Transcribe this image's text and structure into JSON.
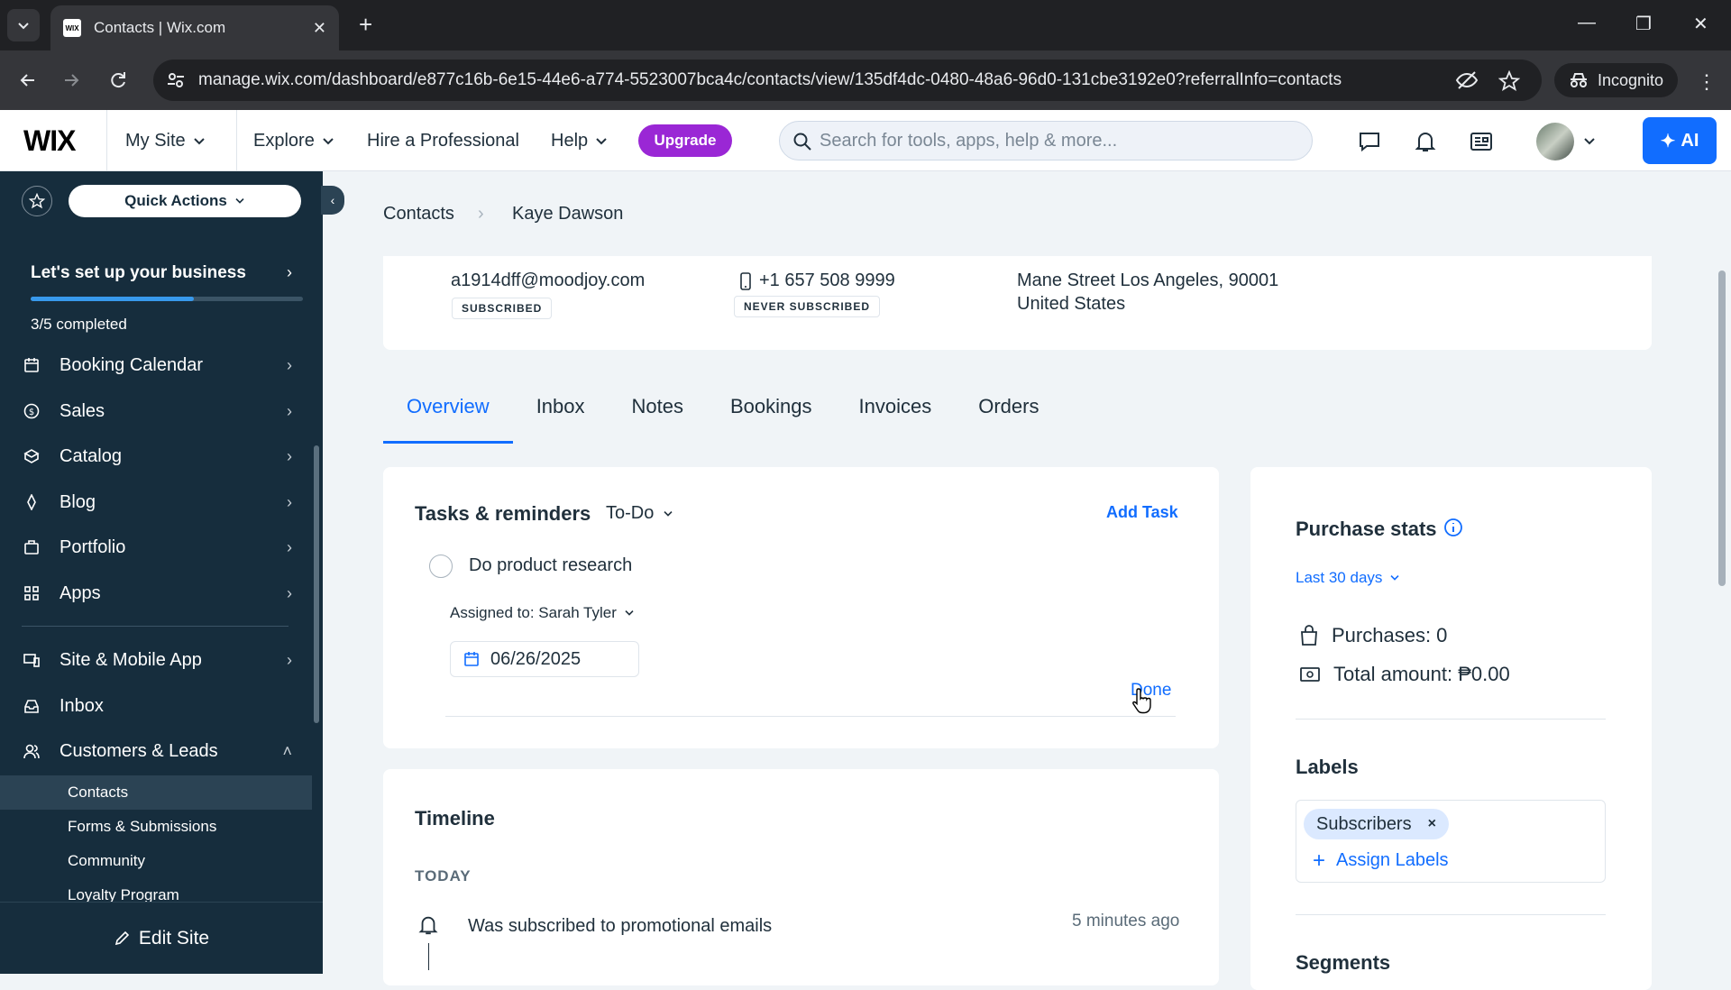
{
  "browser": {
    "tab_title": "Contacts | Wix.com",
    "url": "manage.wix.com/dashboard/e877c16b-6e15-44e6-a774-5523007bca4c/contacts/view/135df4dc-0480-48a6-96d0-131cbe3192e0?referralInfo=contacts",
    "incognito_label": "Incognito"
  },
  "header": {
    "logo": "WIX",
    "my_site": "My Site",
    "explore": "Explore",
    "hire": "Hire a Professional",
    "help": "Help",
    "upgrade": "Upgrade",
    "search_placeholder": "Search for tools, apps, help & more...",
    "ai_label": "AI",
    "accent": "#116dff",
    "upgrade_color": "#9a27d5"
  },
  "sidebar": {
    "quick_actions": "Quick Actions",
    "setup_title": "Let's set up your business",
    "setup_progress": 0.6,
    "setup_count": "3/5 completed",
    "items": [
      {
        "label": "Booking Calendar",
        "icon": "calendar-icon"
      },
      {
        "label": "Sales",
        "icon": "dollar-icon"
      },
      {
        "label": "Catalog",
        "icon": "catalog-icon"
      },
      {
        "label": "Blog",
        "icon": "pen-icon"
      },
      {
        "label": "Portfolio",
        "icon": "portfolio-icon"
      },
      {
        "label": "Apps",
        "icon": "apps-icon"
      },
      {
        "label": "Site & Mobile App",
        "icon": "devices-icon"
      },
      {
        "label": "Inbox",
        "icon": "inbox-icon"
      },
      {
        "label": "Customers & Leads",
        "icon": "people-icon"
      }
    ],
    "sub_items": [
      "Contacts",
      "Forms & Submissions",
      "Community",
      "Loyalty Program"
    ],
    "edit_site": "Edit Site"
  },
  "breadcrumb": {
    "parent": "Contacts",
    "current": "Kaye Dawson"
  },
  "contact": {
    "email": "a1914dff@moodjoy.com",
    "email_status": "SUBSCRIBED",
    "phone": "+1 657 508 9999",
    "phone_status": "NEVER SUBSCRIBED",
    "address_line1": "Mane Street Los Angeles, 90001",
    "address_line2": "United States"
  },
  "tabs": [
    "Overview",
    "Inbox",
    "Notes",
    "Bookings",
    "Invoices",
    "Orders"
  ],
  "tasks": {
    "title": "Tasks & reminders",
    "filter": "To-Do",
    "add_task": "Add Task",
    "task_title": "Do product research",
    "assigned": "Assigned to: Sarah Tyler",
    "due_date": "06/26/2025",
    "done": "Done"
  },
  "timeline": {
    "title": "Timeline",
    "group": "TODAY",
    "event": "Was subscribed to promotional emails",
    "time": "5 minutes ago"
  },
  "purchase_stats": {
    "title": "Purchase stats",
    "range": "Last 30 days",
    "purchases": "Purchases: 0",
    "total": "Total amount: ₱0.00"
  },
  "labels": {
    "title": "Labels",
    "chip": "Subscribers",
    "assign": "Assign Labels"
  },
  "segments": {
    "title": "Segments"
  }
}
